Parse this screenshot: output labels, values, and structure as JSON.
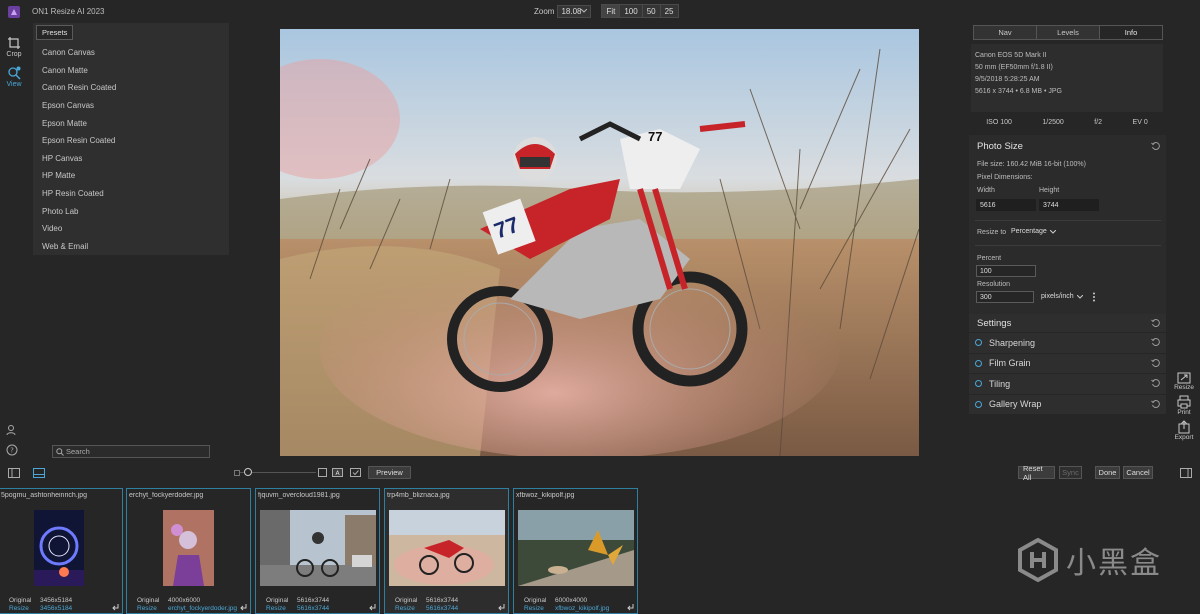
{
  "app": {
    "title": "ON1 Resize AI 2023"
  },
  "zoom": {
    "label": "Zoom",
    "value": "18.08",
    "buttons": [
      "Fit",
      "100",
      "50",
      "25"
    ]
  },
  "left_tools": [
    {
      "name": "crop",
      "label": "Crop"
    },
    {
      "name": "view",
      "label": "View"
    }
  ],
  "presets": {
    "tab_label": "Presets",
    "items": [
      "Canon Canvas",
      "Canon Matte",
      "Canon Resin Coated",
      "Epson Canvas",
      "Epson Matte",
      "Epson Resin Coated",
      "HP Canvas",
      "HP Matte",
      "HP Resin Coated",
      "Photo Lab",
      "Video",
      "Web & Email"
    ]
  },
  "search": {
    "placeholder": "Search"
  },
  "right_panel": {
    "tabs": [
      "Nav",
      "Levels",
      "Info"
    ],
    "info": [
      "Canon EOS 5D Mark II",
      "50 mm (EF50mm f/1.8 II)",
      "9/5/2018 5:28:25 AM",
      "5616 x 3744 • 6.8 MB • JPG"
    ],
    "exif": [
      "ISO 100",
      "1/2500",
      "f/2",
      "EV 0"
    ],
    "photo_size": {
      "title": "Photo Size",
      "file_size": "File size: 160.42 MiB 16-bit (100%)",
      "pixel_dims_label": "Pixel Dimensions:",
      "width_label": "Width",
      "height_label": "Height",
      "width_value": "5616",
      "height_value": "3744",
      "resize_to_label": "Resize to",
      "resize_to_value": "Percentage",
      "percent_label": "Percent",
      "percent_value": "100",
      "resolution_label": "Resolution",
      "resolution_value": "300",
      "resolution_unit": "pixels/inch"
    },
    "settings": {
      "title": "Settings",
      "items": [
        "Sharpening",
        "Film Grain",
        "Tiling",
        "Gallery Wrap"
      ]
    }
  },
  "right_tools": [
    {
      "name": "resize",
      "label": "Resize"
    },
    {
      "name": "print",
      "label": "Print"
    },
    {
      "name": "export",
      "label": "Export"
    }
  ],
  "toolbar": {
    "preview_label": "Preview",
    "reset_all": "Reset All",
    "sync": "Sync",
    "done": "Done",
    "cancel": "Cancel"
  },
  "filmstrip": [
    {
      "name": "5pogmu_ashtonheinrich.jpg",
      "orig_label": "Original",
      "orig_value": "3456x5184",
      "resize_label": "Resize",
      "resize_value": "3456x5184"
    },
    {
      "name": "erchyt_fockyerdoder.jpg",
      "orig_label": "Original",
      "orig_value": "4000x6000",
      "resize_label": "Resize",
      "resize_value": "erchyt_fockyerdoder.jpg"
    },
    {
      "name": "fjquvm_overcloud1981.jpg",
      "orig_label": "Original",
      "orig_value": "5616x3744",
      "resize_label": "Resize",
      "resize_value": "5616x3744"
    },
    {
      "name": "trp4mb_bliznaca.jpg",
      "orig_label": "Original",
      "orig_value": "5616x3744",
      "resize_label": "Resize",
      "resize_value": "5616x3744"
    },
    {
      "name": "xfbwoz_kikipolf.jpg",
      "orig_label": "Original",
      "orig_value": "6000x4000",
      "resize_label": "Resize",
      "resize_value": "xfbwoz_kikipolf.jpg"
    }
  ],
  "watermark": {
    "text": "小黑盒"
  }
}
